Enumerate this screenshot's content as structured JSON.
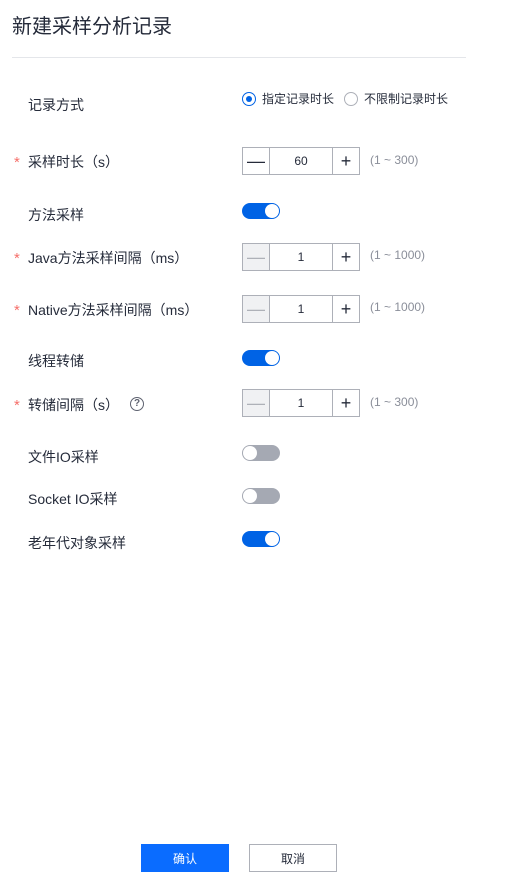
{
  "title": "新建采样分析记录",
  "record_mode": {
    "label": "记录方式",
    "options": [
      {
        "label": "指定记录时长",
        "checked": true
      },
      {
        "label": "不限制记录时长",
        "checked": false
      }
    ]
  },
  "sample_duration": {
    "label": "采样时长（s）",
    "required": "*",
    "value": "60",
    "range": "(1 ~ 300)",
    "minus": "—",
    "plus": "+"
  },
  "method_sampling": {
    "label": "方法采样",
    "on": true
  },
  "java_interval": {
    "label": "Java方法采样间隔（ms）",
    "required": "*",
    "value": "1",
    "range": "(1 ~ 1000)",
    "minus": "—",
    "plus": "+"
  },
  "native_interval": {
    "label": "Native方法采样间隔（ms）",
    "required": "*",
    "value": "1",
    "range": "(1 ~ 1000)",
    "minus": "—",
    "plus": "+"
  },
  "thread_dump": {
    "label": "线程转储",
    "on": true
  },
  "dump_interval": {
    "label": "转储间隔（s）",
    "required": "*",
    "help": "?",
    "value": "1",
    "range": "(1 ~ 300)",
    "minus": "—",
    "plus": "+"
  },
  "file_io": {
    "label": "文件IO采样",
    "on": false
  },
  "socket_io": {
    "label": "Socket IO采样",
    "on": false
  },
  "old_gen": {
    "label": "老年代对象采样",
    "on": true
  },
  "buttons": {
    "confirm": "确认",
    "cancel": "取消"
  },
  "colors": {
    "accent": "#0063e5",
    "required": "#f66f6a",
    "toggle_off": "#a5a9b3"
  }
}
